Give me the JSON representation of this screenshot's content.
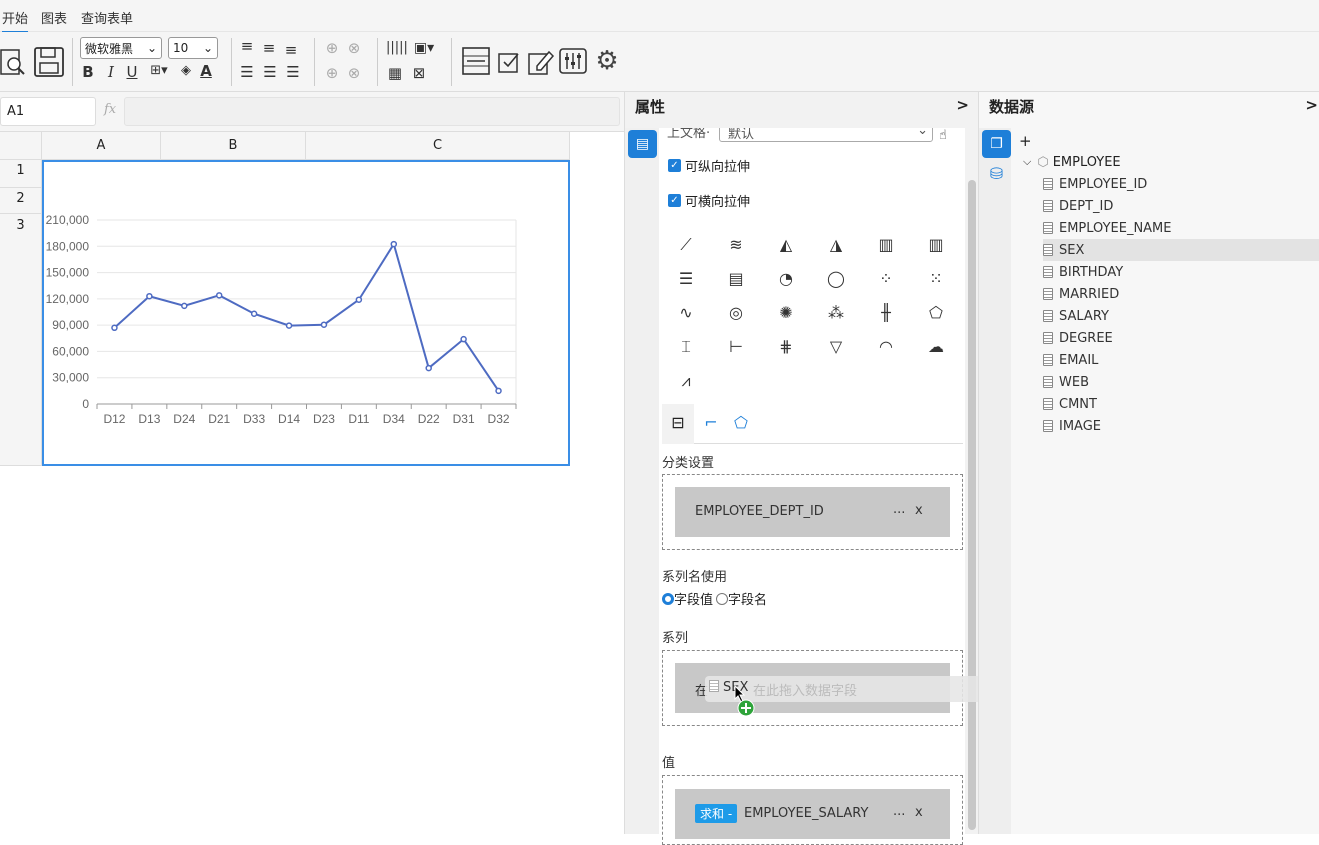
{
  "ribbon_tabs": [
    {
      "label": "开始",
      "active": true
    },
    {
      "label": "图表",
      "active": false
    },
    {
      "label": "查询表单",
      "active": false
    }
  ],
  "toolbar": {
    "font_name": "微软雅黑",
    "font_size": "10",
    "bold": "B",
    "italic": "I",
    "underline": "U",
    "color_a": "A"
  },
  "formula_bar": {
    "cell_ref": "A1",
    "fx": "fx",
    "value": ""
  },
  "sheet": {
    "columns": [
      "A",
      "B",
      "C"
    ],
    "rows": [
      "1",
      "2",
      "3"
    ]
  },
  "chart_data": {
    "type": "line",
    "categories": [
      "D12",
      "D13",
      "D24",
      "D21",
      "D33",
      "D14",
      "D23",
      "D11",
      "D34",
      "D22",
      "D31",
      "D32"
    ],
    "values": [
      87000,
      123000,
      112000,
      124000,
      103000,
      89500,
      90500,
      119000,
      182500,
      41000,
      74000,
      15000
    ],
    "ylim": [
      0,
      210000
    ],
    "yticks": [
      "210,000",
      "180,000",
      "150,000",
      "120,000",
      "90,000",
      "60,000",
      "30,000",
      "0"
    ],
    "color": "#4e6bc2",
    "grid": true
  },
  "properties": {
    "title": "属性",
    "collapse": ">",
    "partial_label": "上文格·",
    "partial_value": "默认",
    "chk_vertical": "可纵向拉伸",
    "chk_horizontal": "可横向拉伸",
    "category_title": "分类设置",
    "category_field": "EMPLOYEE_DEPT_ID",
    "more": "...",
    "remove": "x",
    "series_name_title": "系列名使用",
    "radio_field_value": "字段值",
    "radio_field_name": "字段名",
    "series_title": "系列",
    "series_placeholder": "在此拖入数据字段",
    "drag_prefix": "在",
    "drag_field": "SEX",
    "value_title": "值",
    "value_agg": "求和",
    "value_caret": "-",
    "value_field": "EMPLOYEE_SALARY"
  },
  "datasource": {
    "title": "数据源",
    "collapse": ">",
    "add": "+",
    "table": "EMPLOYEE",
    "fields": [
      "EMPLOYEE_ID",
      "DEPT_ID",
      "EMPLOYEE_NAME",
      "SEX",
      "BIRTHDAY",
      "MARRIED",
      "SALARY",
      "DEGREE",
      "EMAIL",
      "WEB",
      "CMNT",
      "IMAGE"
    ],
    "selected": "SEX"
  }
}
